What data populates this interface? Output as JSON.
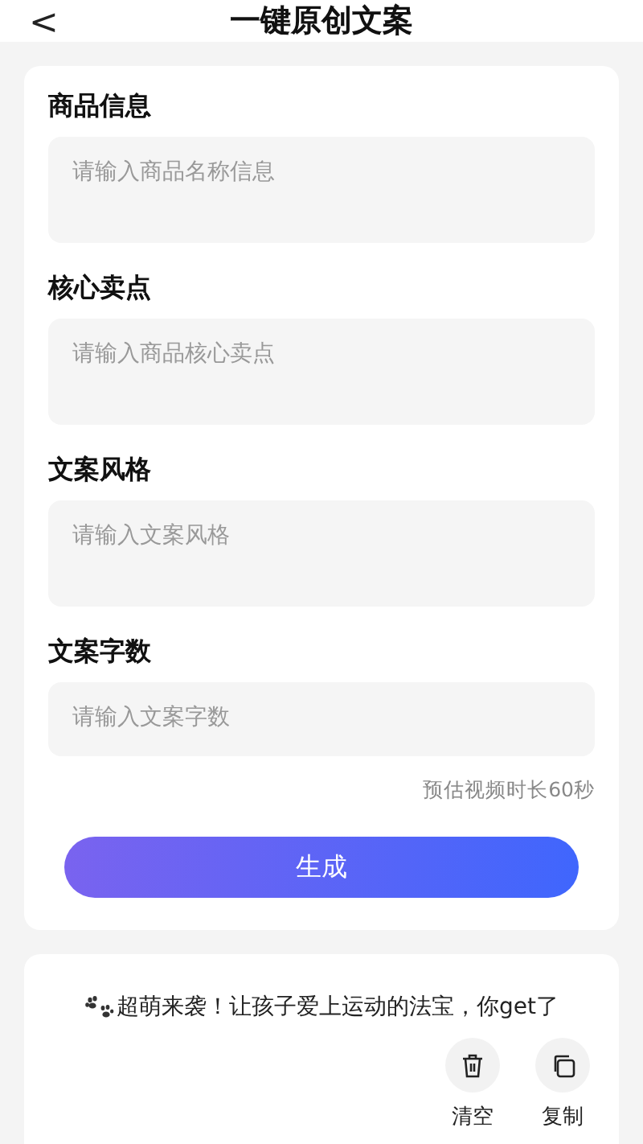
{
  "header": {
    "back": "<",
    "title": "一键原创文案"
  },
  "fields": [
    {
      "label": "商品信息",
      "placeholder": "请输入商品名称信息",
      "kind": "multiline"
    },
    {
      "label": "核心卖点",
      "placeholder": "请输入商品核心卖点",
      "kind": "multiline"
    },
    {
      "label": "文案风格",
      "placeholder": "请输入文案风格",
      "kind": "multiline"
    },
    {
      "label": "文案字数",
      "placeholder": "请输入文案字数",
      "kind": "single"
    }
  ],
  "hint": "预估视频时长60秒",
  "generate_button": "生成",
  "result": {
    "text": "超萌来袭！让孩子爱上运动的法宝，你get了",
    "actions": [
      {
        "kind": "clear",
        "label": "清空"
      },
      {
        "kind": "copy",
        "label": "复制"
      }
    ]
  }
}
